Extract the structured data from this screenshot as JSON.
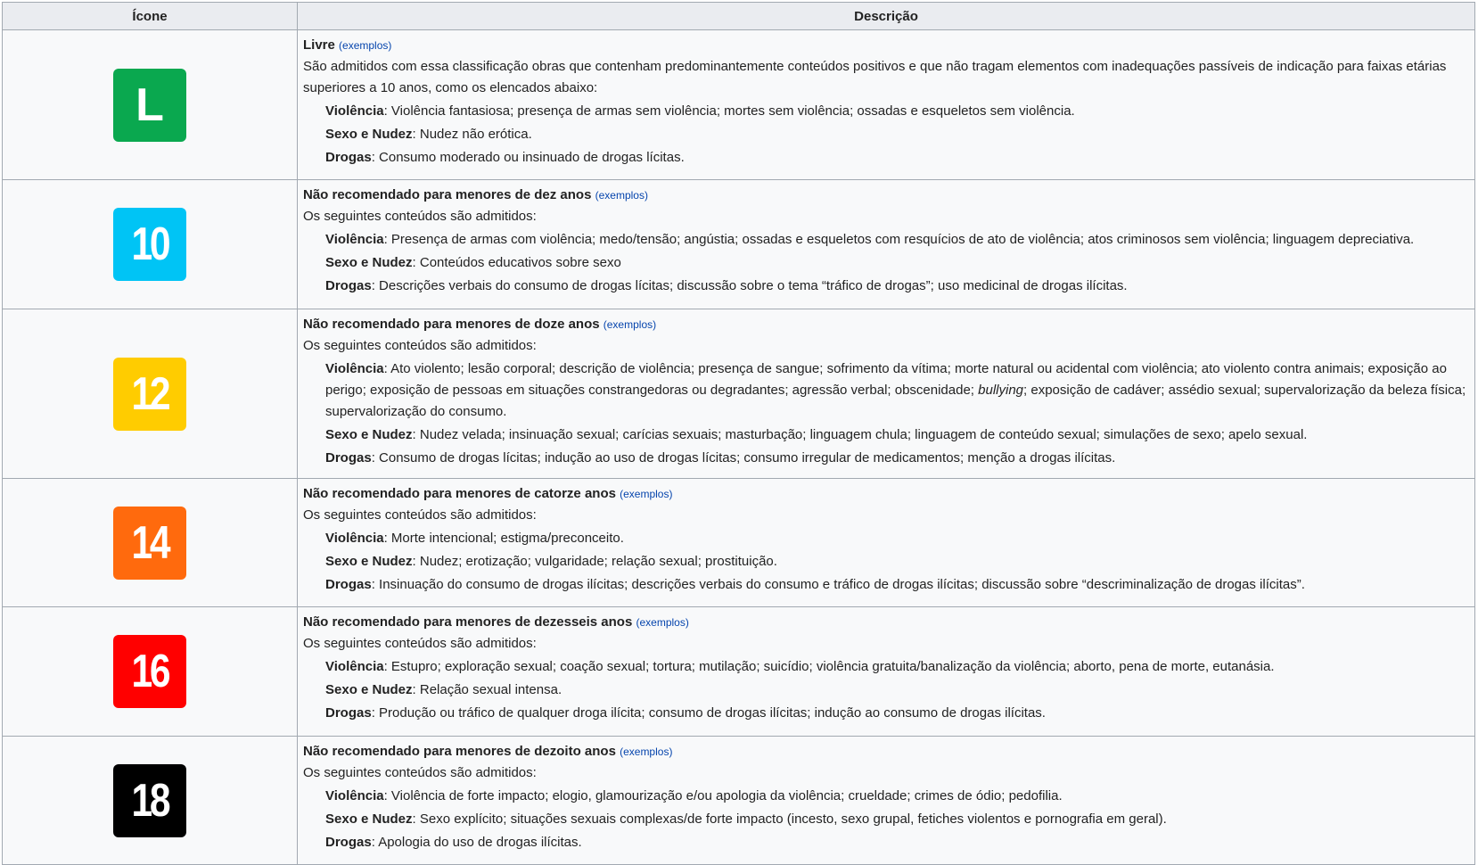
{
  "headers": {
    "icon": "Ícone",
    "description": "Descrição"
  },
  "colors": {
    "L": "#0aa84f",
    "10": "#00c4f5",
    "12": "#ffcc00",
    "14": "#ff6a0d",
    "16": "#ff0000",
    "18": "#000000"
  },
  "rows": [
    {
      "badge": "L",
      "title": "Livre",
      "examples": "(exemplos)",
      "intro": "São admitidos com essa classificação obras que contenham predominantemente conteúdos positivos e que não tragam elementos com inadequações passíveis de indicação para faixas etárias superiores a 10 anos, como os elencados abaixo:",
      "violence_label": "Violência",
      "violence_text": ": Violência fantasiosa; presença de armas sem violência; mortes sem violência; ossadas e esqueletos sem violência.",
      "sex_label": "Sexo e Nudez",
      "sex_text": ": Nudez não erótica.",
      "drugs_label": "Drogas",
      "drugs_text": ": Consumo moderado ou insinuado de drogas lícitas."
    },
    {
      "badge": "10",
      "title": "Não recomendado para menores de dez anos",
      "examples": "(exemplos)",
      "intro": "Os seguintes conteúdos são admitidos:",
      "violence_label": "Violência",
      "violence_text": ": Presença de armas com violência; medo/tensão; angústia; ossadas e esqueletos com resquícios de ato de violência; atos criminosos sem violência; linguagem depreciativa.",
      "sex_label": "Sexo e Nudez",
      "sex_text": ": Conteúdos educativos sobre sexo",
      "drugs_label": "Drogas",
      "drugs_text": ": Descrições verbais do consumo de drogas lícitas; discussão sobre o tema “tráfico de drogas”; uso medicinal de drogas ilícitas."
    },
    {
      "badge": "12",
      "title": "Não recomendado para menores de doze anos",
      "examples": "(exemplos)",
      "intro": "Os seguintes conteúdos são admitidos:",
      "violence_label": "Violência",
      "violence_text_a": ": Ato violento; lesão corporal; descrição de violência; presença de sangue; sofrimento da vítima; morte natural ou acidental com violência; ato violento contra animais; exposição ao perigo; exposição de pessoas em situações constrangedoras ou degradantes; agressão verbal; obscenidade; ",
      "violence_italic": "bullying",
      "violence_text_b": "; exposição de cadáver; assédio sexual; supervalorização da beleza física; supervalorização do consumo.",
      "sex_label": "Sexo e Nudez",
      "sex_text": ": Nudez velada; insinuação sexual; carícias sexuais; masturbação; linguagem chula; linguagem de conteúdo sexual; simulações de sexo; apelo sexual.",
      "drugs_label": "Drogas",
      "drugs_text": ": Consumo de drogas lícitas; indução ao uso de drogas lícitas; consumo irregular de medicamentos; menção a drogas ilícitas."
    },
    {
      "badge": "14",
      "title": "Não recomendado para menores de catorze anos",
      "examples": "(exemplos)",
      "intro": "Os seguintes conteúdos são admitidos:",
      "violence_label": "Violência",
      "violence_text": ": Morte intencional; estigma/preconceito.",
      "sex_label": "Sexo e Nudez",
      "sex_text": ": Nudez; erotização; vulgaridade; relação sexual; prostituição.",
      "drugs_label": "Drogas",
      "drugs_text": ": Insinuação do consumo de drogas ilícitas; descrições verbais do consumo e tráfico de drogas ilícitas; discussão sobre “descriminalização de drogas ilícitas”."
    },
    {
      "badge": "16",
      "title": "Não recomendado para menores de dezesseis anos",
      "examples": "(exemplos)",
      "intro": "Os seguintes conteúdos são admitidos:",
      "violence_label": "Violência",
      "violence_text": ": Estupro; exploração sexual; coação sexual; tortura; mutilação; suicídio; violência gratuita/banalização da violência; aborto, pena de morte, eutanásia.",
      "sex_label": "Sexo e Nudez",
      "sex_text": ": Relação sexual intensa.",
      "drugs_label": "Drogas",
      "drugs_text": ": Produção ou tráfico de qualquer droga ilícita; consumo de drogas ilícitas; indução ao consumo de drogas ilícitas."
    },
    {
      "badge": "18",
      "title": "Não recomendado para menores de dezoito anos",
      "examples": "(exemplos)",
      "intro": "Os seguintes conteúdos são admitidos:",
      "violence_label": "Violência",
      "violence_text": ": Violência de forte impacto; elogio, glamourização e/ou apologia da violência; crueldade; crimes de ódio; pedofilia.",
      "sex_label": "Sexo e Nudez",
      "sex_text": ": Sexo explícito; situações sexuais complexas/de forte impacto (incesto, sexo grupal, fetiches violentos e pornografia em geral).",
      "drugs_label": "Drogas",
      "drugs_text": ": Apologia do uso de drogas ilícitas."
    }
  ]
}
